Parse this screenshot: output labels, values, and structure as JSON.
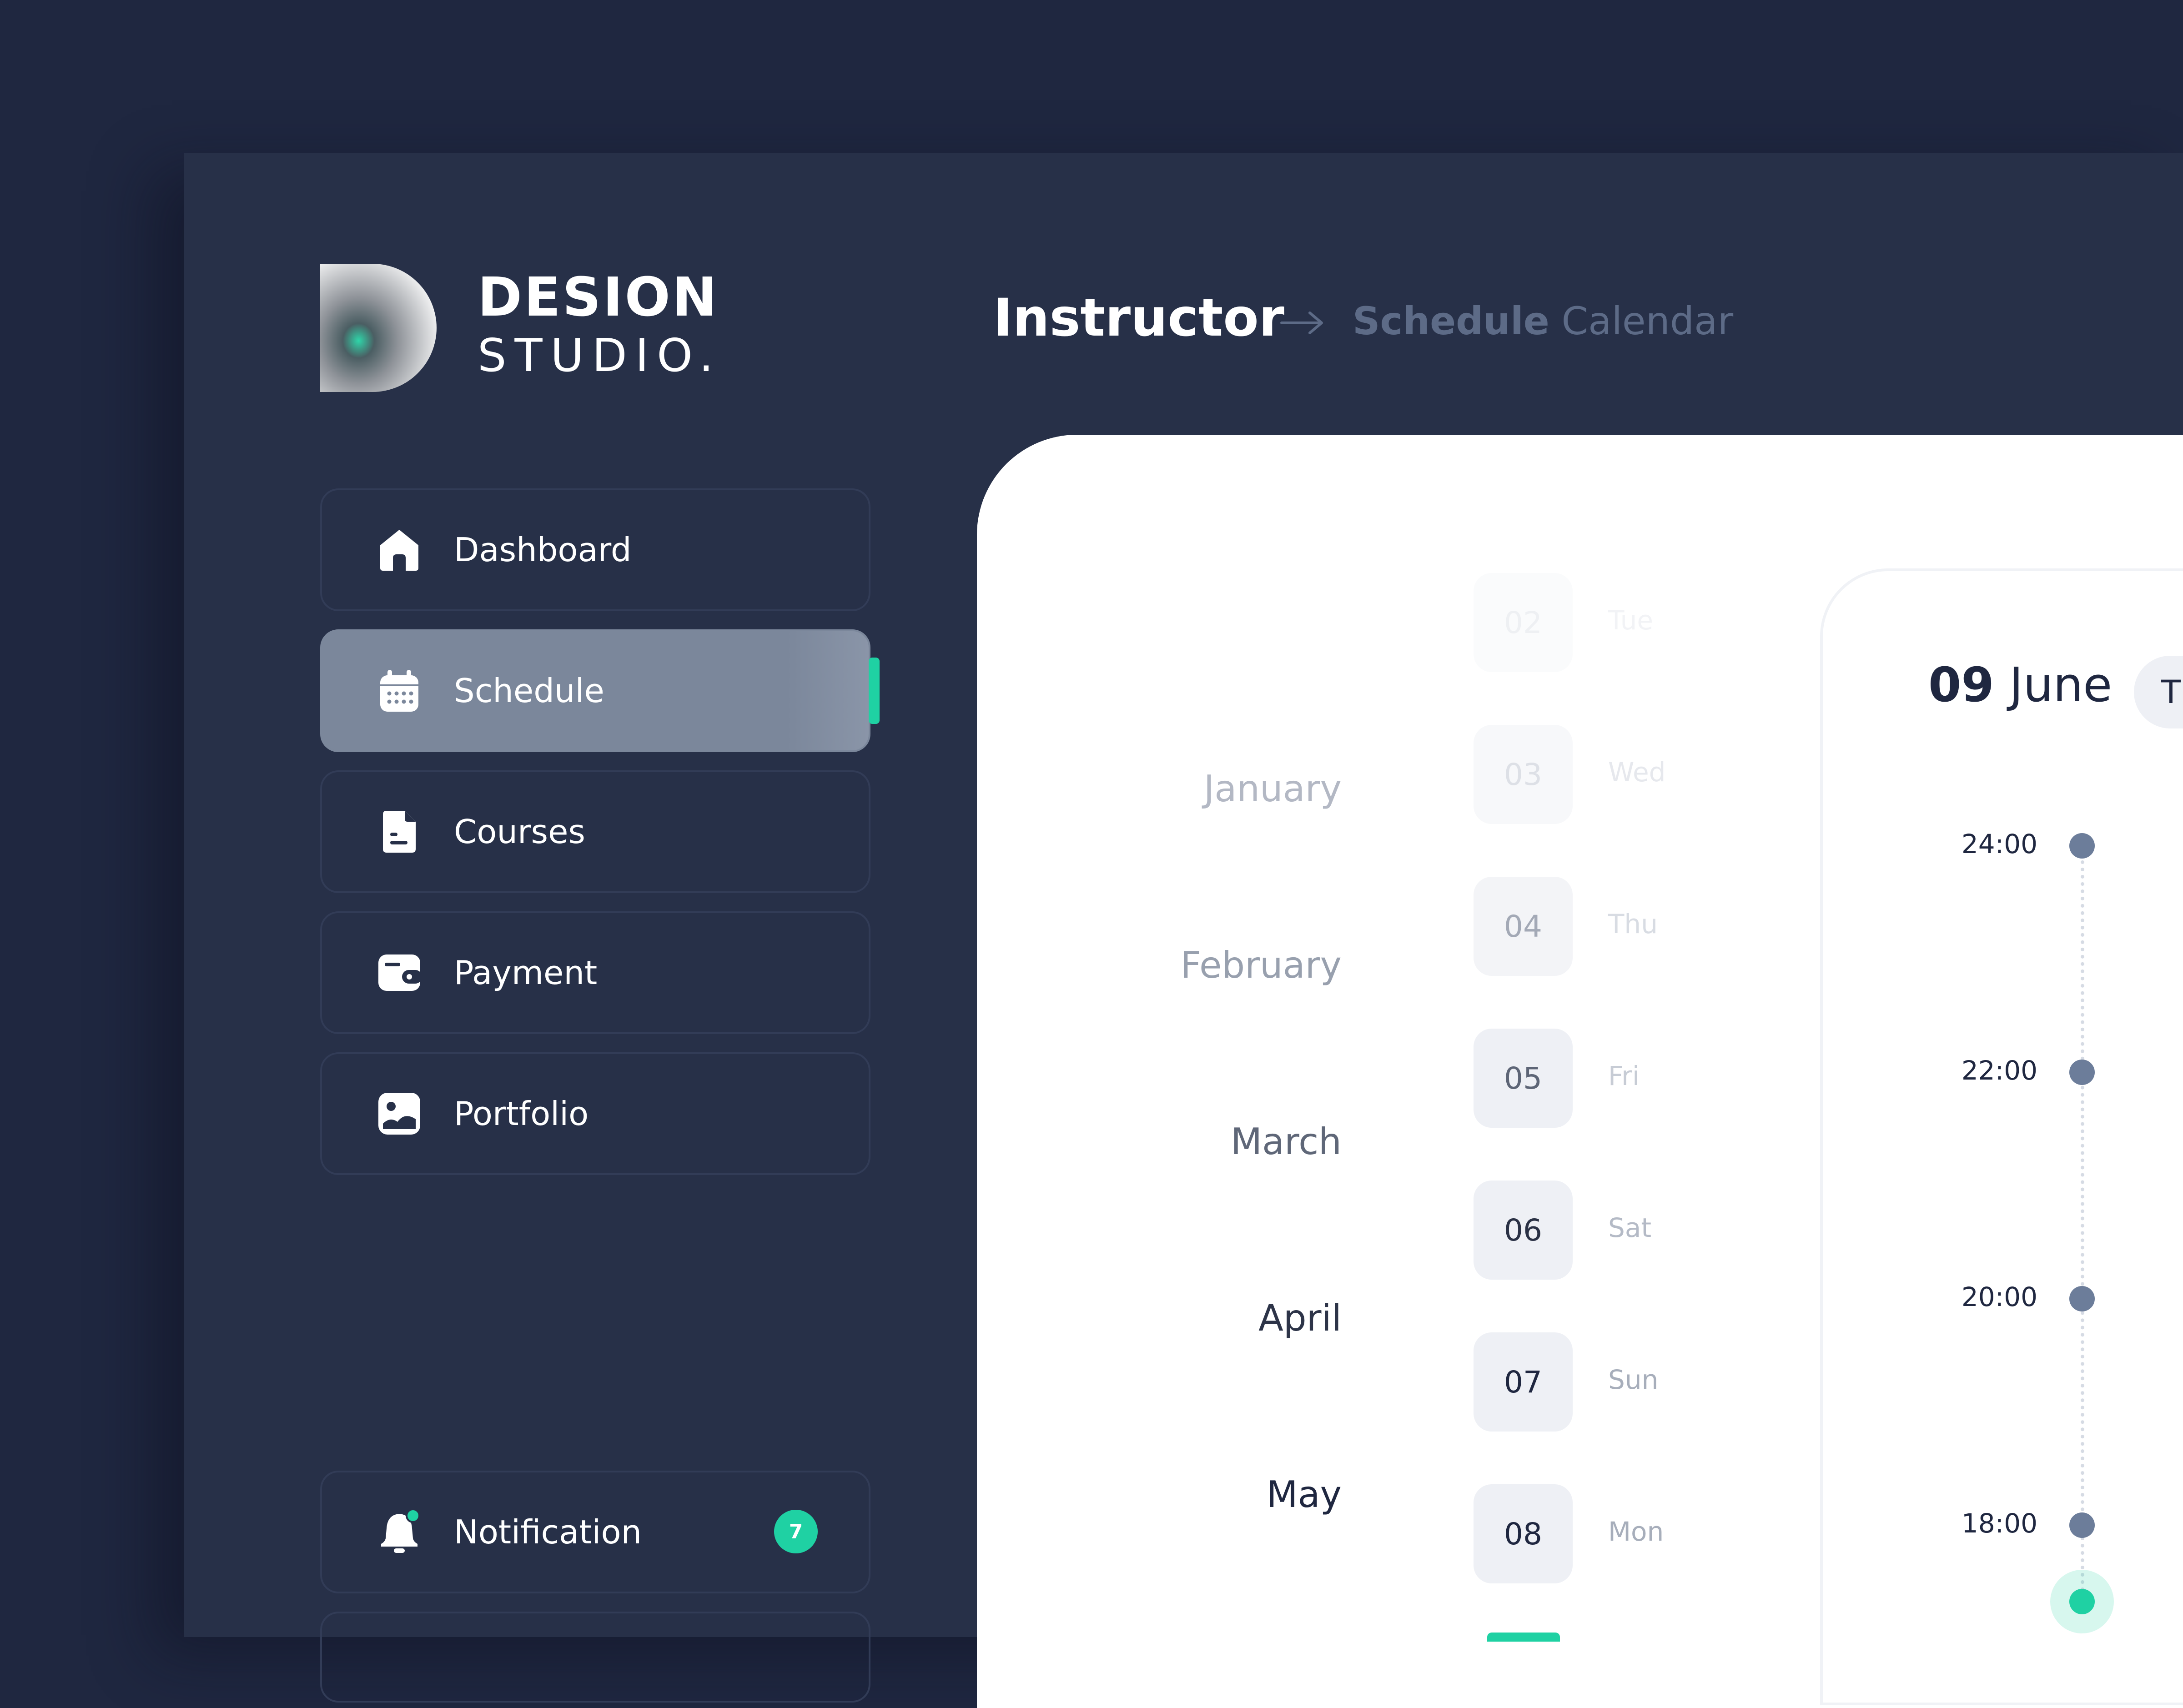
{
  "brand": {
    "line1": "DESION",
    "line2": "STUDIO."
  },
  "sidebar": {
    "items": [
      {
        "label": "Dashboard",
        "icon": "home-icon"
      },
      {
        "label": "Schedule",
        "icon": "calendar-icon",
        "active": true
      },
      {
        "label": "Courses",
        "icon": "document-icon"
      },
      {
        "label": "Payment",
        "icon": "wallet-icon"
      },
      {
        "label": "Portfolio",
        "icon": "image-icon"
      }
    ],
    "notification": {
      "label": "Notification",
      "icon": "bell-icon",
      "count": "7"
    }
  },
  "breadcrumb": {
    "main": "Instructor",
    "sub_bold": "Schedule",
    "sub_rest": " Calendar"
  },
  "months": [
    "January",
    "February",
    "March",
    "April",
    "May"
  ],
  "days": [
    {
      "num": "02",
      "name": "Tue"
    },
    {
      "num": "03",
      "name": "Wed"
    },
    {
      "num": "04",
      "name": "Thu"
    },
    {
      "num": "05",
      "name": "Fri"
    },
    {
      "num": "06",
      "name": "Sat"
    },
    {
      "num": "07",
      "name": "Sun"
    },
    {
      "num": "08",
      "name": "Mon"
    }
  ],
  "schedule": {
    "day": "09",
    "month": "June",
    "pill_label": "T",
    "times": [
      "24:00",
      "22:00",
      "20:00",
      "18:00"
    ]
  },
  "colors": {
    "background": "#1f2740",
    "window": "#273048",
    "accent": "#1fd1a3",
    "active_item": "#7b879b",
    "muted": "#5d6b87"
  }
}
